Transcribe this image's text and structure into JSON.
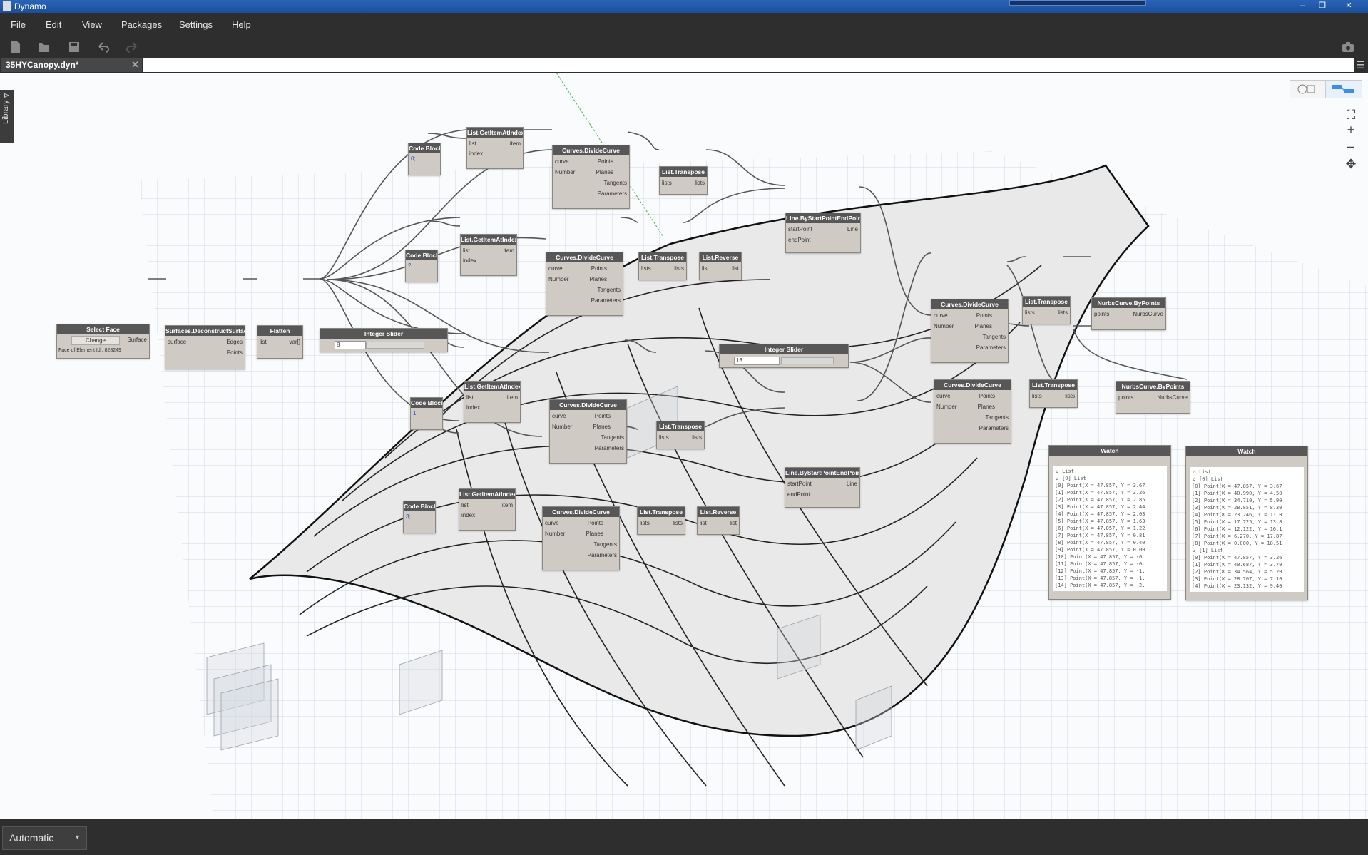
{
  "window": {
    "title": "Dynamo"
  },
  "menu": [
    "File",
    "Edit",
    "View",
    "Packages",
    "Settings",
    "Help"
  ],
  "tab": {
    "label": "35HYCanopy.dyn*",
    "close": "✕"
  },
  "library": {
    "label": "Library",
    "arrow": "⊳"
  },
  "run_mode": {
    "value": "Automatic"
  },
  "nodes": {
    "select_face": {
      "title": "Select Face",
      "button": "Change",
      "output": "Surface",
      "info": "Face of Element Id : 828249"
    },
    "deconstruct": {
      "title": "Surfaces.DeconstructSurface",
      "input": "surface",
      "out1": "Edges",
      "out2": "Points"
    },
    "flatten": {
      "title": "Flatten",
      "input": "list",
      "output": "var[]"
    },
    "slider1": {
      "title": "Integer Slider",
      "value": "8"
    },
    "slider2": {
      "title": "Integer Slider",
      "value": "18"
    },
    "cb1": {
      "title": "Code Block",
      "code": "0;"
    },
    "cb2": {
      "title": "Code Block",
      "code": "2;"
    },
    "cb3": {
      "title": "Code Block",
      "code": "1;"
    },
    "cb4": {
      "title": "Code Block",
      "code": "3;"
    },
    "gi1": {
      "title": "List.GetItemAtIndex",
      "in1": "list",
      "in2": "index",
      "out": "item"
    },
    "gi2": {
      "title": "List.GetItemAtIndex",
      "in1": "list",
      "in2": "index",
      "out": "item"
    },
    "gi3": {
      "title": "List.GetItemAtIndex",
      "in1": "list",
      "in2": "index",
      "out": "item"
    },
    "gi4": {
      "title": "List.GetItemAtIndex",
      "in1": "list",
      "in2": "index",
      "out": "item"
    },
    "dc1": {
      "title": "Curves.DivideCurve",
      "in1": "curve",
      "in2": "Number",
      "o1": "Points",
      "o2": "Planes",
      "o3": "Tangents",
      "o4": "Parameters"
    },
    "dc2": {
      "title": "Curves.DivideCurve",
      "in1": "curve",
      "in2": "Number",
      "o1": "Points",
      "o2": "Planes",
      "o3": "Tangents",
      "o4": "Parameters"
    },
    "dc3": {
      "title": "Curves.DivideCurve",
      "in1": "curve",
      "in2": "Number",
      "o1": "Points",
      "o2": "Planes",
      "o3": "Tangents",
      "o4": "Parameters"
    },
    "dc4": {
      "title": "Curves.DivideCurve",
      "in1": "curve",
      "in2": "Number",
      "o1": "Points",
      "o2": "Planes",
      "o3": "Tangents",
      "o4": "Parameters"
    },
    "dc5": {
      "title": "Curves.DivideCurve",
      "in1": "curve",
      "in2": "Number",
      "o1": "Points",
      "o2": "Planes",
      "o3": "Tangents",
      "o4": "Parameters"
    },
    "dc6": {
      "title": "Curves.DivideCurve",
      "in1": "curve",
      "in2": "Number",
      "o1": "Points",
      "o2": "Planes",
      "o3": "Tangents",
      "o4": "Parameters"
    },
    "tr1": {
      "title": "List.Transpose",
      "in": "lists",
      "out": "lists"
    },
    "tr2": {
      "title": "List.Transpose",
      "in": "lists",
      "out": "lists"
    },
    "tr3": {
      "title": "List.Transpose",
      "in": "lists",
      "out": "lists"
    },
    "tr4": {
      "title": "List.Transpose",
      "in": "lists",
      "out": "lists"
    },
    "tr5": {
      "title": "List.Transpose",
      "in": "lists",
      "out": "lists"
    },
    "tr6": {
      "title": "List.Transpose",
      "in": "lists",
      "out": "lists"
    },
    "rv1": {
      "title": "List.Reverse",
      "in": "list",
      "out": "list"
    },
    "rv2": {
      "title": "List.Reverse",
      "in": "list",
      "out": "list"
    },
    "ln1": {
      "title": "Line.ByStartPointEndPoint",
      "in1": "startPoint",
      "in2": "endPoint",
      "out": "Line"
    },
    "ln2": {
      "title": "Line.ByStartPointEndPoint",
      "in1": "startPoint",
      "in2": "endPoint",
      "out": "Line"
    },
    "nb1": {
      "title": "NurbsCurve.ByPoints",
      "in": "points",
      "out": "NurbsCurve"
    },
    "nb2": {
      "title": "NurbsCurve.ByPoints",
      "in": "points",
      "out": "NurbsCurve"
    },
    "watch1": {
      "title": "Watch",
      "lines": [
        "⊿ List",
        "  ⊿ [0] List",
        "    [0] Point(X = 47.857, Y = 3.67",
        "    [1] Point(X = 47.857, Y = 3.26",
        "    [2] Point(X = 47.857, Y = 2.85",
        "    [3] Point(X = 47.857, Y = 2.44",
        "    [4] Point(X = 47.857, Y = 2.03",
        "    [5] Point(X = 47.857, Y = 1.63",
        "    [6] Point(X = 47.857, Y = 1.22",
        "    [7] Point(X = 47.857, Y = 0.81",
        "    [8] Point(X = 47.857, Y = 0.40",
        "    [9] Point(X = 47.857, Y = 0.00",
        "    [10] Point(X = 47.857, Y = -0.",
        "    [11] Point(X = 47.857, Y = -0.",
        "    [12] Point(X = 47.857, Y = -1.",
        "    [13] Point(X = 47.857, Y = -1.",
        "    [14] Point(X = 47.857, Y = -2."
      ]
    },
    "watch2": {
      "title": "Watch",
      "lines": [
        "⊿ List",
        "  ⊿ [0] List",
        "    [0] Point(X = 47.857, Y = 3.67",
        "    [1] Point(X = 40.990, Y = 4.50",
        "    [2] Point(X = 34.710, Y = 5.90",
        "    [3] Point(X = 28.851, Y = 8.30",
        "    [4] Point(X = 23.246, Y = 11.0",
        "    [5] Point(X = 17.725, Y = 13.8",
        "    [6] Point(X = 12.122, Y = 16.1",
        "    [7] Point(X = 6.270, Y = 17.87",
        "    [8] Point(X = 0.000, Y = 18.51",
        "  ⊿ [1] List",
        "    [0] Point(X = 47.857, Y = 3.26",
        "    [1] Point(X = 40.687, Y = 3.70",
        "    [2] Point(X = 34.564, Y = 5.20",
        "    [3] Point(X = 28.707, Y = 7.10",
        "    [4] Point(X = 23.132, Y = 9.40"
      ]
    }
  },
  "colors": {
    "titlebar": "#1b4f9c",
    "chrome": "#2e2e2e",
    "node_header": "#575757",
    "node_body": "#cfcbc4",
    "canvas": "#fafbfc",
    "grid": "#b7c3d6"
  }
}
